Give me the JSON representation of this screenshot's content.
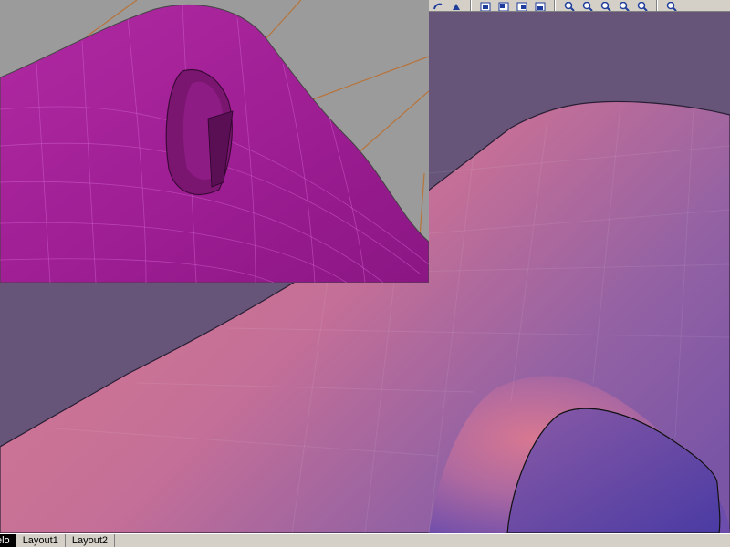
{
  "colors": {
    "viewport_background": "#665579",
    "surface_pink": "#c8708f",
    "surface_purple": "#8b5aa0",
    "inset_background": "#9b9b9b",
    "inset_mesh": "#a31d96",
    "construction_lines": "#b8733a",
    "toolbar_icon": "#1f3d9a"
  },
  "toolbar": {
    "icons": [
      "realtime-pan-icon",
      "shade-view-icon",
      "view-restore-icon",
      "view-restore-icon",
      "view-restore-icon",
      "view-restore-icon",
      "zoom-in-icon",
      "zoom-realtime-icon",
      "zoom-window-icon",
      "zoom-extents-icon",
      "zoom-previous-icon",
      "zoom-out-icon"
    ]
  },
  "tabs": [
    {
      "label": "elo",
      "active": true
    },
    {
      "label": "Layout1",
      "active": false
    },
    {
      "label": "Layout2",
      "active": false
    }
  ]
}
